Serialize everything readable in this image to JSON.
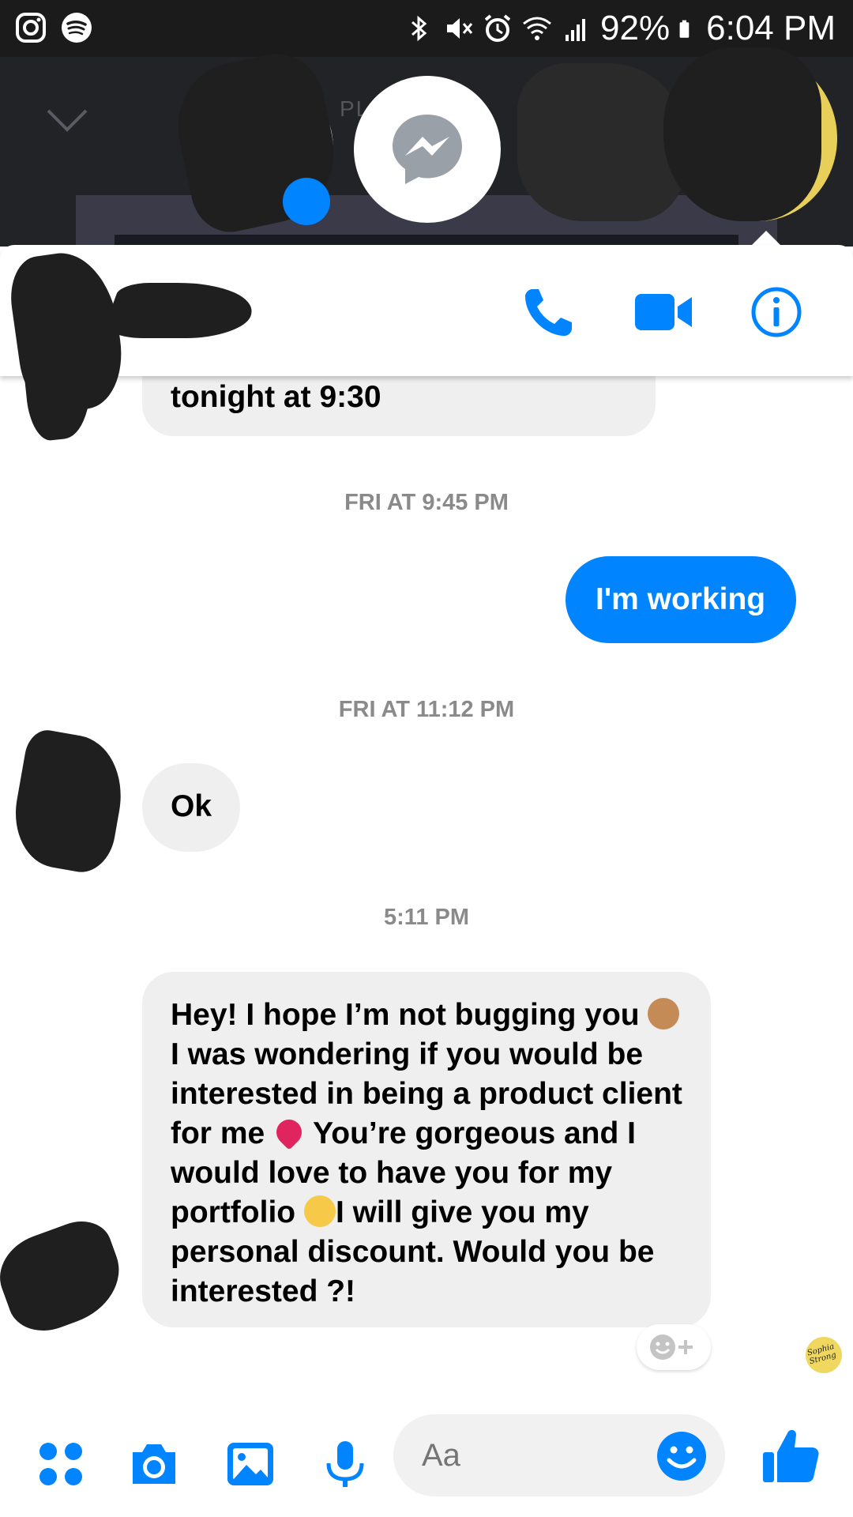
{
  "status_bar": {
    "battery": "92%",
    "time": "6:04 PM"
  },
  "overlay": {
    "faint_text": "PL           M"
  },
  "messages": {
    "first_partial": "tonight at 9:30",
    "ts1": "FRI AT 9:45 PM",
    "outgoing": "I'm working",
    "ts2": "FRI AT 11:12 PM",
    "reply_ok": "Ok",
    "ts3": "5:11 PM",
    "long_part1": "Hey! I hope I’m not bugging you",
    "long_part2": " I was wondering if you would be interested in being a product client for me ",
    "long_part3": " You’re gorgeous and I would love to have you for my portfolio ",
    "long_part4": "I will give you my personal discount. Would you be interested ?!"
  },
  "seen": {
    "label": "Sophia Strong"
  },
  "composer": {
    "placeholder": "Aa"
  },
  "colors": {
    "accent": "#0084ff",
    "incoming_bubble": "#efefef",
    "status_bar": "#1b1b1b"
  },
  "icons": {
    "status_left": [
      "instagram-icon",
      "spotify-icon"
    ],
    "status_right": [
      "bluetooth-icon",
      "mute-icon",
      "alarm-icon",
      "wifi-icon",
      "signal-icon",
      "battery-icon"
    ],
    "header": [
      "phone-icon",
      "video-icon",
      "info-icon"
    ],
    "composer": [
      "more-icon",
      "camera-icon",
      "gallery-icon",
      "mic-icon",
      "emoji-icon",
      "like-icon"
    ]
  }
}
